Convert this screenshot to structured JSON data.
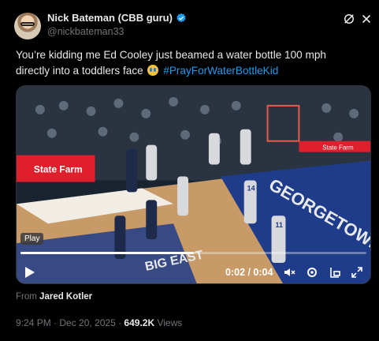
{
  "header": {
    "display_name": "Nick Bateman (CBB guru)",
    "handle": "@nickbateman33",
    "verified": true
  },
  "tweet": {
    "text_line1": "You’re kidding me Ed Cooley just beamed a water bottle 100 mph",
    "text_line2_prefix": "directly into a toddlers face",
    "emoji": "loudly-crying-face",
    "hashtag": "#PrayForWaterBottleKid"
  },
  "video": {
    "play_badge": "Play",
    "time": "0:02 / 0:04",
    "progress": 0.5,
    "banner_text": "State Farm",
    "court_text": "GEORGETOWN",
    "court_logo": "BIG EAST",
    "jersey_numbers": [
      "14",
      "11"
    ]
  },
  "footer": {
    "from_prefix": "From",
    "from_name": "Jared Kotler",
    "timestamp": "9:24 PM · Dec 20, 2025 ·",
    "views_count": "649.2K",
    "views_label": "Views"
  },
  "colors": {
    "background": "#000000",
    "text": "#e7e9ea",
    "muted": "#71767b",
    "accent": "#1d9bf0"
  }
}
